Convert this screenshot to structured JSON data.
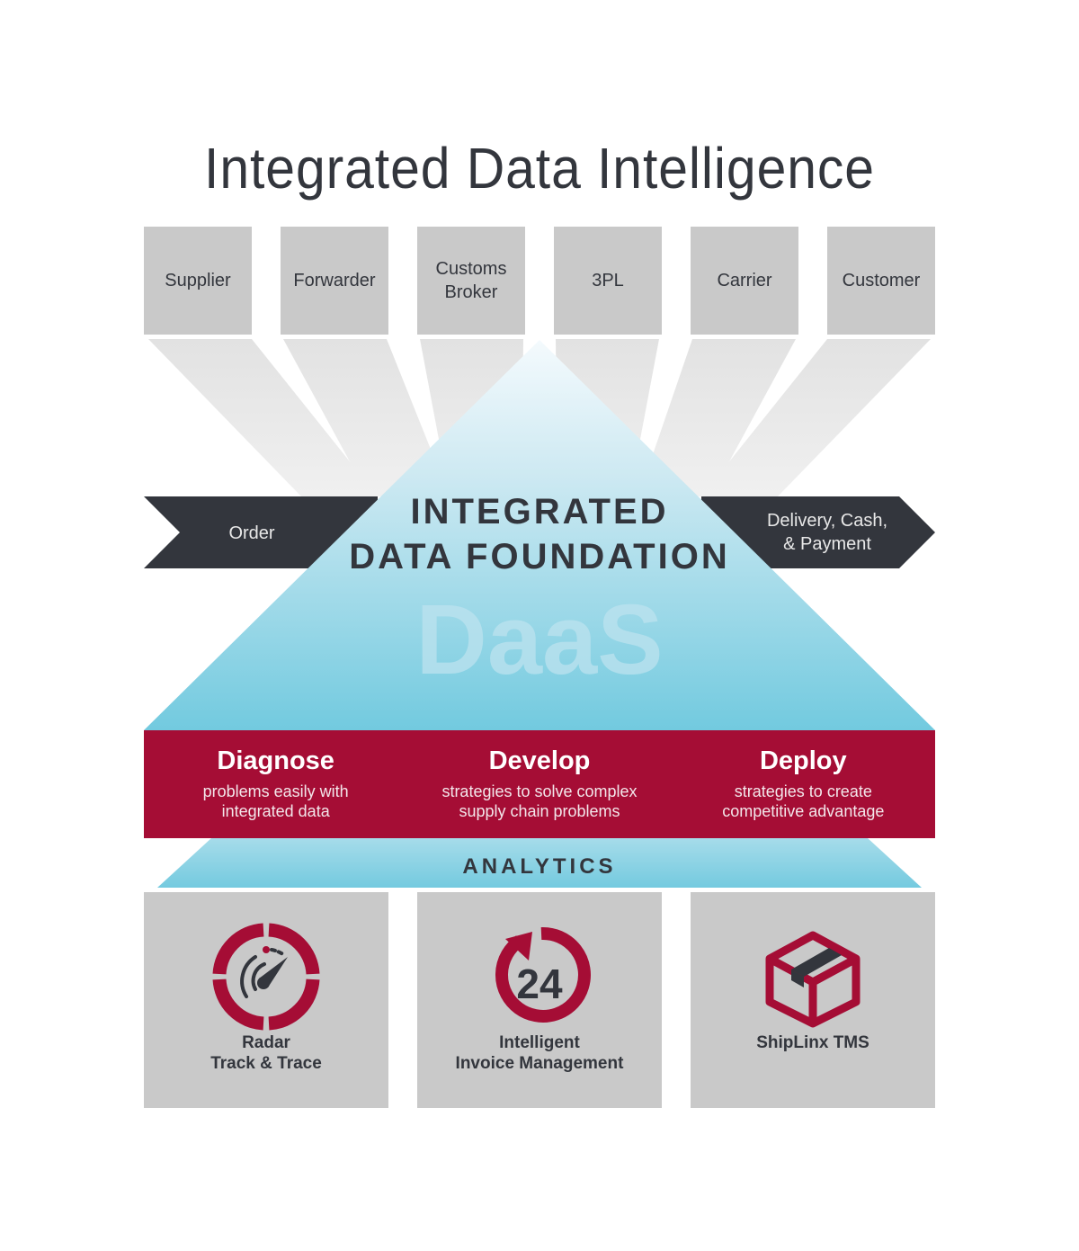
{
  "title": "Integrated Data Intelligence",
  "parties": [
    {
      "label": "Supplier"
    },
    {
      "label": "Forwarder"
    },
    {
      "label": "Customs\nBroker"
    },
    {
      "label": "3PL"
    },
    {
      "label": "Carrier"
    },
    {
      "label": "Customer"
    }
  ],
  "flow": {
    "start_label": "Order",
    "end_label": "Delivery, Cash,\n& Payment"
  },
  "foundation": {
    "line1": "INTEGRATED",
    "line2": "DATA FOUNDATION",
    "watermark": "DaaS"
  },
  "band": [
    {
      "heading": "Diagnose",
      "desc": "problems easily with\nintegrated data"
    },
    {
      "heading": "Develop",
      "desc": "strategies to solve complex\nsupply chain problems"
    },
    {
      "heading": "Deploy",
      "desc": "strategies to create\ncompetitive advantage"
    }
  ],
  "analytics_label": "ANALYTICS",
  "products": [
    {
      "label": "Radar\nTrack & Trace",
      "icon": "radar-gauge-icon"
    },
    {
      "label": "Intelligent\nInvoice Management",
      "icon": "24-hour-cycle-icon"
    },
    {
      "label": "ShipLinx TMS",
      "icon": "package-box-icon"
    }
  ],
  "colors": {
    "dark": "#33363d",
    "crimson": "#a50d35",
    "tile_gray": "#c9c9c9",
    "funnel_gray": "#e6e6e6",
    "cyan_top": "#f2f9fc",
    "cyan_bottom": "#72cadf"
  }
}
